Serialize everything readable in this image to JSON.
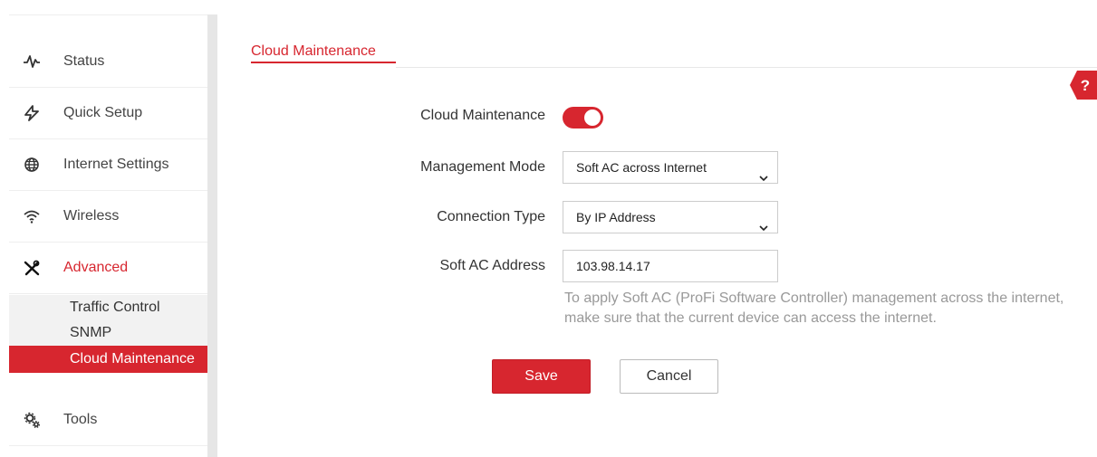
{
  "sidebar": {
    "items": [
      {
        "label": "Status",
        "icon": "pulse-icon"
      },
      {
        "label": "Quick Setup",
        "icon": "lightning-icon"
      },
      {
        "label": "Internet Settings",
        "icon": "globe-icon"
      },
      {
        "label": "Wireless",
        "icon": "wifi-icon"
      },
      {
        "label": "Advanced",
        "icon": "tools-cross-icon",
        "active": true
      },
      {
        "label": "Tools",
        "icon": "gears-icon"
      }
    ],
    "submenu": [
      {
        "label": "Traffic Control"
      },
      {
        "label": "SNMP"
      },
      {
        "label": "Cloud Maintenance",
        "selected": true
      }
    ]
  },
  "main": {
    "tab_title": "Cloud Maintenance",
    "help_icon": "?",
    "form": {
      "cloud_maintenance_label": "Cloud Maintenance",
      "cloud_maintenance_enabled": true,
      "management_mode_label": "Management Mode",
      "management_mode_value": "Soft AC across Internet",
      "connection_type_label": "Connection Type",
      "connection_type_value": "By IP Address",
      "soft_ac_address_label": "Soft AC Address",
      "soft_ac_address_value": "103.98.14.17",
      "hint": "To apply Soft AC (ProFi Software Controller) management across the internet, make sure that the current device can access the internet."
    },
    "buttons": {
      "save": "Save",
      "cancel": "Cancel"
    }
  },
  "colors": {
    "accent": "#d7262f"
  }
}
